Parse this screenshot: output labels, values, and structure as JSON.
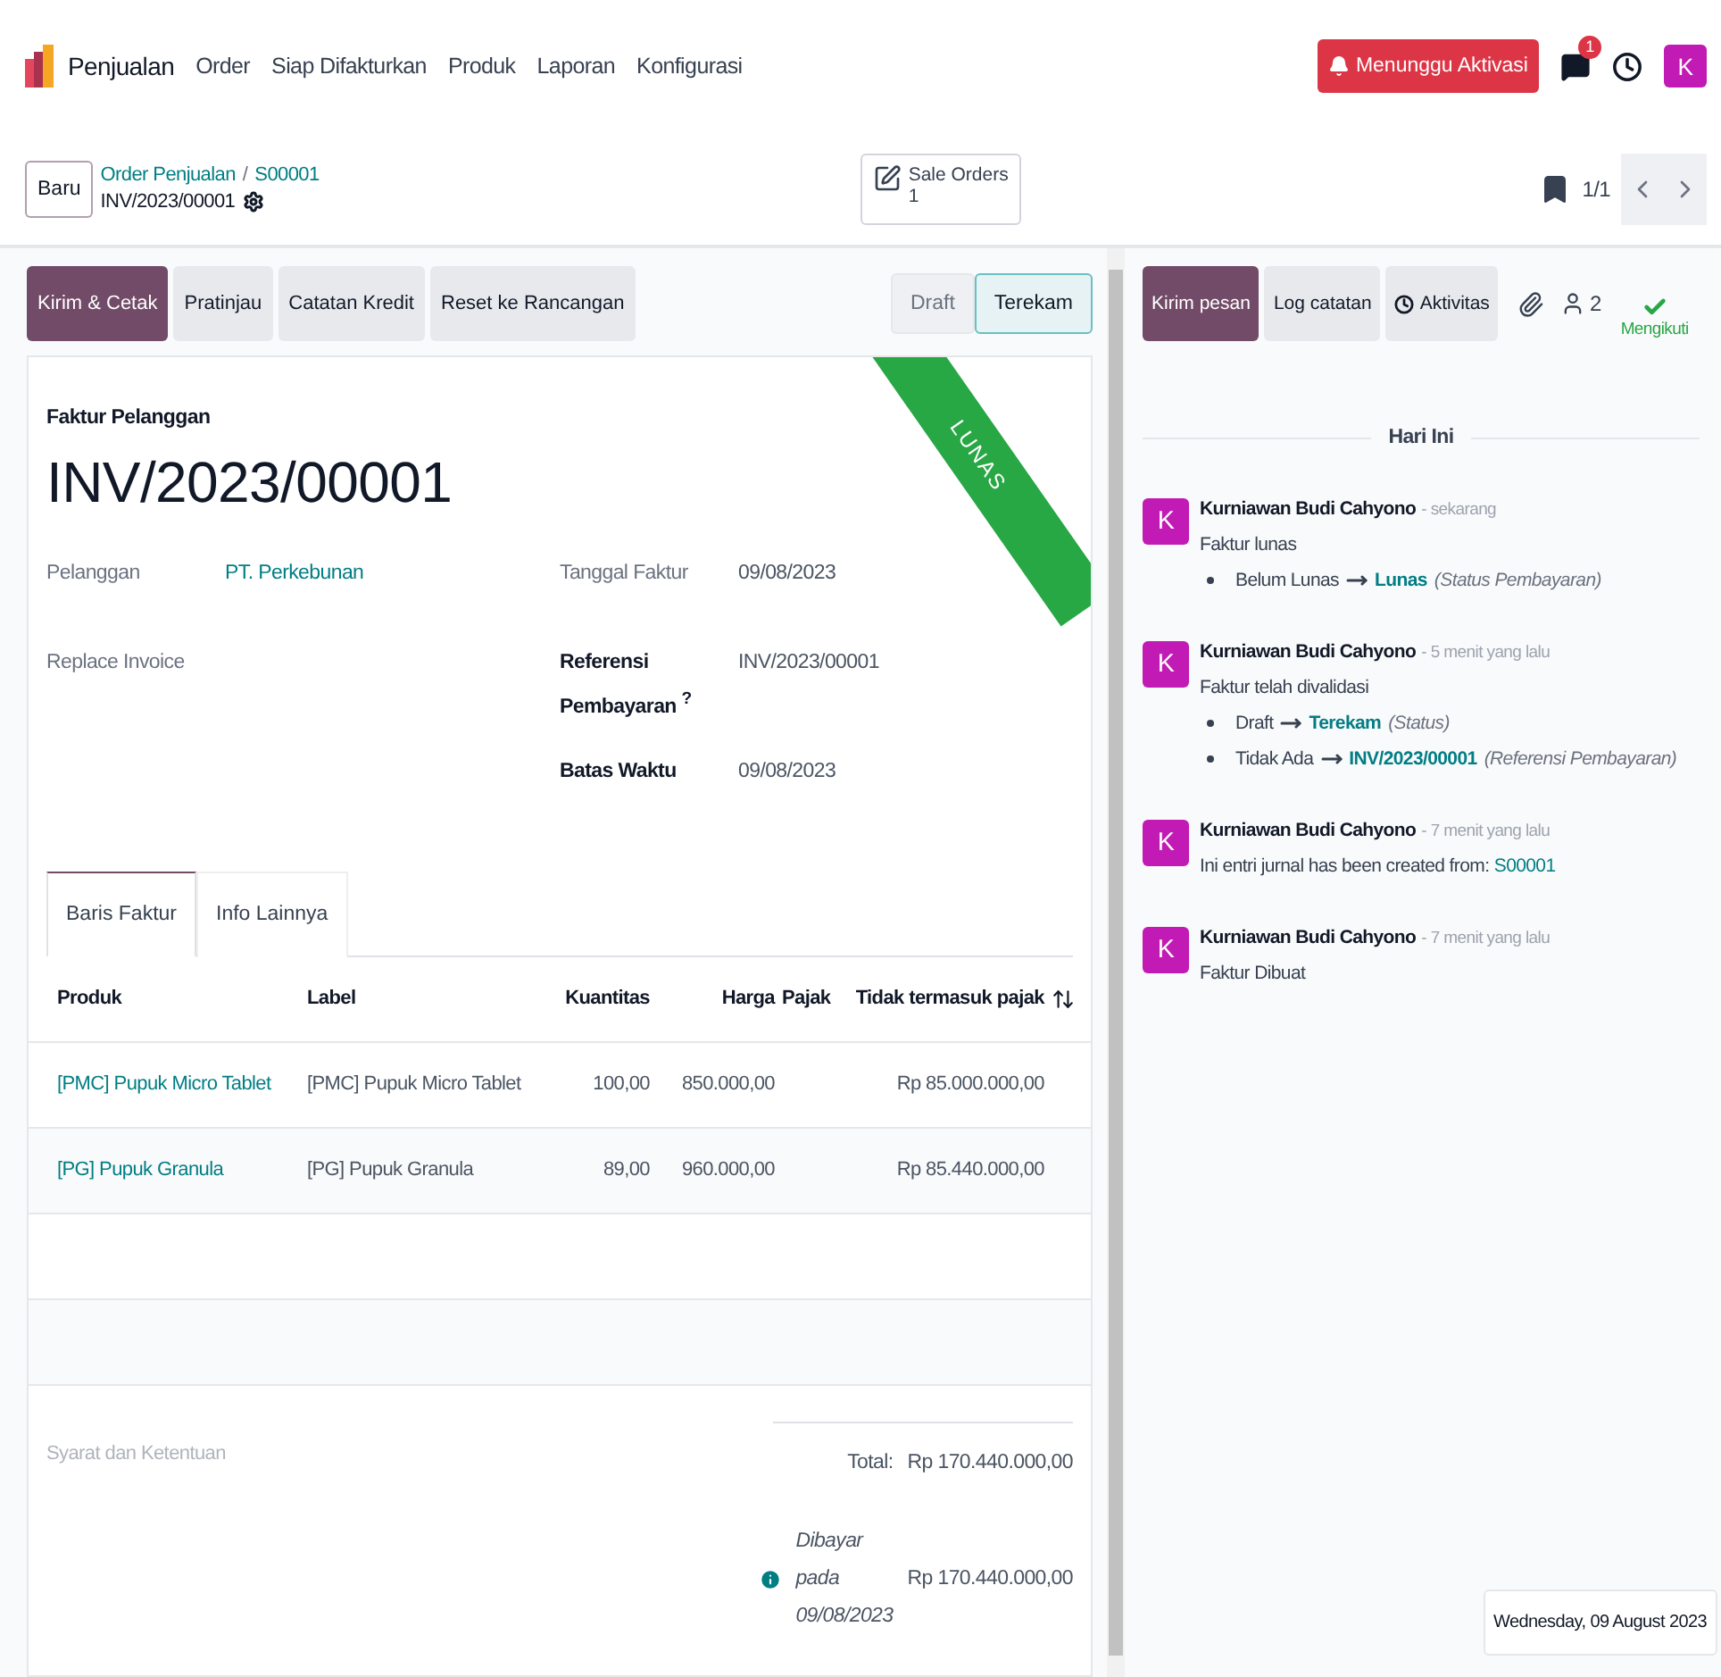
{
  "nav": {
    "app": "Penjualan",
    "menu": [
      "Order",
      "Siap Difakturkan",
      "Produk",
      "Laporan",
      "Konfigurasi"
    ],
    "alert": "Menunggu Aktivasi",
    "chat_badge": "1",
    "avatar": "K"
  },
  "control": {
    "new_button": "Baru",
    "breadcrumb": [
      "Order Penjualan",
      "S00001"
    ],
    "breadcrumb_separator": "/",
    "record": "INV/2023/00001",
    "smart_button": {
      "label": "Sale Orders",
      "count": "1"
    },
    "pager": "1/1"
  },
  "actions": [
    {
      "label": "Kirim & Cetak",
      "kind": "primary"
    },
    {
      "label": "Pratinjau",
      "kind": "secondary"
    },
    {
      "label": "Catatan Kredit",
      "kind": "secondary"
    },
    {
      "label": "Reset ke Rancangan",
      "kind": "secondary"
    }
  ],
  "statuses": [
    {
      "label": "Draft",
      "selected": false
    },
    {
      "label": "Terekam",
      "selected": true
    }
  ],
  "sheet": {
    "ribbon": "LUNAS",
    "subtitle": "Faktur Pelanggan",
    "title": "INV/2023/00001",
    "left_fields": [
      {
        "label": "Pelanggan",
        "value": "PT. Perkebunan",
        "strong": false
      },
      {
        "label": "Replace Invoice",
        "strong": false
      }
    ],
    "right_fields": [
      {
        "label": "Tanggal Faktur",
        "value": "09/08/2023",
        "strong": false
      },
      {
        "label": "Referensi Pembayaran $^{?}$",
        "value": "INV/2023/00001",
        "strong": true
      },
      {
        "label": "Batas Waktu",
        "value": "09/08/2023",
        "strong": true
      }
    ],
    "tabs": [
      {
        "label": "Baris Faktur",
        "selected": true
      },
      {
        "label": "Info Lainnya",
        "selected": false
      }
    ],
    "table": {
      "columns": [
        "Produk",
        "Label",
        "Kuantitas",
        "Harga",
        "Pajak",
        "Tidak termasuk pajak"
      ],
      "rows": [
        [
          "[PMC] Pupuk Micro Tablet",
          "[PMC] Pupuk Micro Tablet",
          "100,00",
          "850.000,00",
          "",
          "Rp 85.000.000,00"
        ],
        [
          "[PG] Pupuk Granula",
          "[PG] Pupuk Granula",
          "89,00",
          "960.000,00",
          "",
          "Rp 85.440.000,00"
        ]
      ]
    },
    "terms_placeholder": "Syarat dan Ketentuan",
    "totals": [
      {
        "label": "Total:",
        "value": "Rp 170.440.000,00",
        "kind": "total"
      },
      {
        "label": "Dibayar pada 09/08/2023",
        "value": "Rp 170.440.000,00",
        "kind": "payment"
      }
    ]
  },
  "chatter": {
    "buttons": [
      {
        "label": "Kirim pesan",
        "kind": "primary"
      },
      {
        "label": "Log catatan",
        "kind": "secondary"
      },
      {
        "label": "Aktivitas",
        "kind": "activity"
      }
    ],
    "followers": "2",
    "follow_label": "Mengikuti",
    "day": "Hari Ini",
    "messages": [
      {
        "avatar": "K",
        "author": "Kurniawan Budi Cahyono",
        "time": "- sekarang",
        "body": "Faktur lunas",
        "changes": [
          {
            "from": "Belum Lunas",
            "to": "Lunas",
            "field": "(Status Pembayaran)"
          }
        ]
      },
      {
        "avatar": "K",
        "author": "Kurniawan Budi Cahyono",
        "time": "- 5 menit yang lalu",
        "body": "Faktur telah divalidasi",
        "changes": [
          {
            "from": "Draft",
            "to": "Terekam",
            "field": "(Status)"
          },
          {
            "from": "Tidak Ada",
            "to": "INV/2023/00001",
            "field": "(Referensi Pembayaran)"
          }
        ]
      },
      {
        "avatar": "K",
        "author": "Kurniawan Budi Cahyono",
        "time": "- 7 menit yang lalu",
        "body": "Ini entri jurnal has been created from:",
        "link": "S00001"
      },
      {
        "avatar": "K",
        "author": "Kurniawan Budi Cahyono",
        "time": "- 7 menit yang lalu",
        "body": "Faktur Dibuat"
      }
    ],
    "date_tooltip": "Wednesday, 09 August 2023"
  }
}
